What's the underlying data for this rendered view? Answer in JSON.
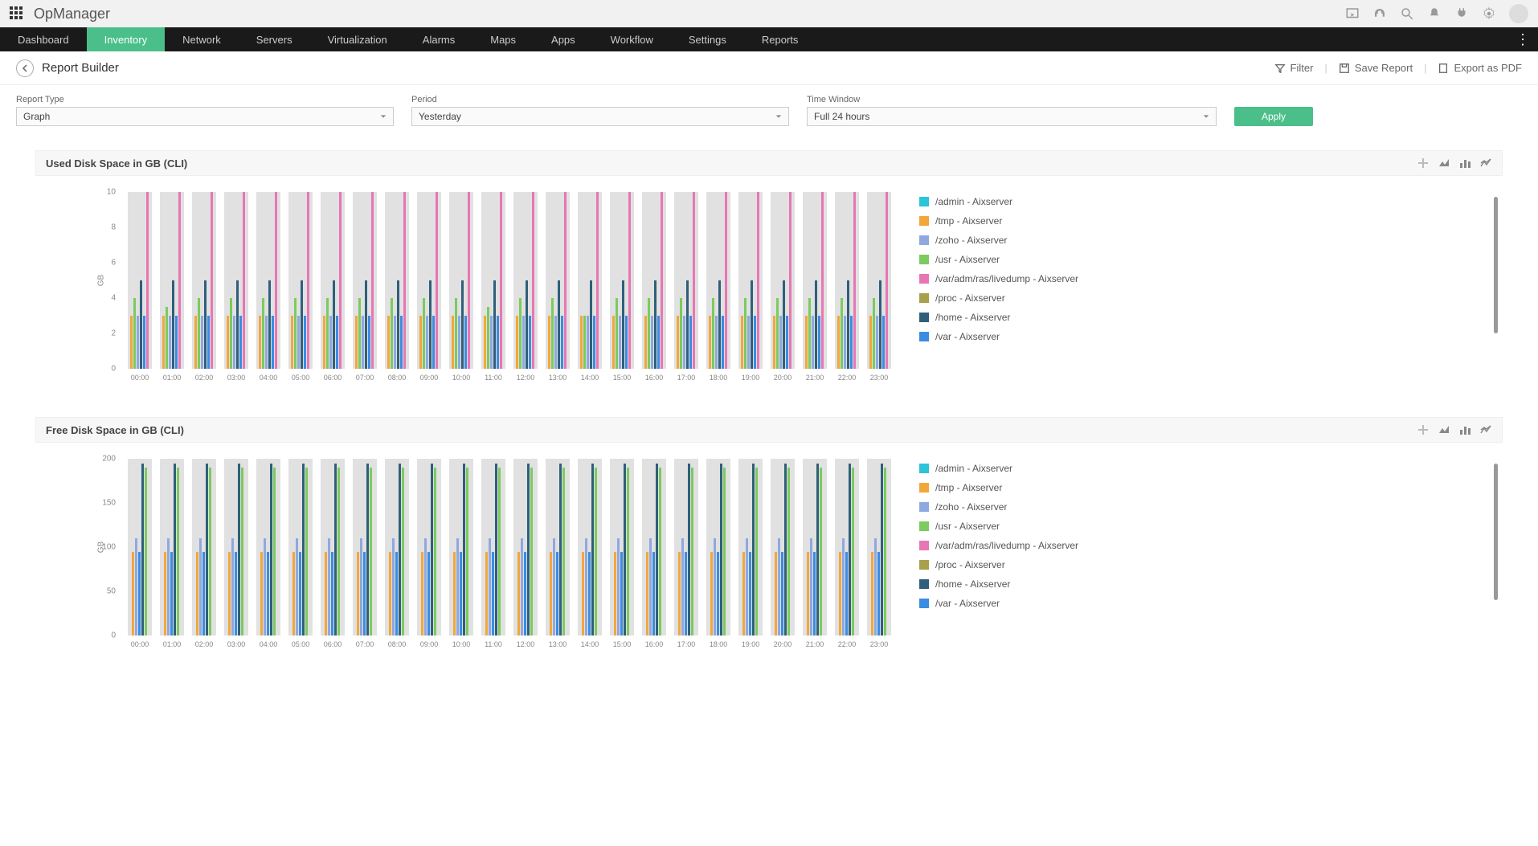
{
  "brand": "OpManager",
  "nav": [
    "Dashboard",
    "Inventory",
    "Network",
    "Servers",
    "Virtualization",
    "Alarms",
    "Maps",
    "Apps",
    "Workflow",
    "Settings",
    "Reports"
  ],
  "nav_active": "Inventory",
  "page": {
    "title": "Report Builder"
  },
  "actions": {
    "filter": "Filter",
    "save": "Save Report",
    "export": "Export as PDF"
  },
  "filters": {
    "report_type": {
      "label": "Report Type",
      "value": "Graph"
    },
    "period": {
      "label": "Period",
      "value": "Yesterday"
    },
    "time_window": {
      "label": "Time Window",
      "value": "Full 24 hours"
    },
    "apply": "Apply"
  },
  "series_colors": {
    "/admin - Aixserver": "#2bc4d8",
    "/tmp - Aixserver": "#f2a73b",
    "/zoho - Aixserver": "#8fa8e0",
    "/usr - Aixserver": "#7bcb5e",
    "/var/adm/ras/livedump - Aixserver": "#e876b5",
    "/proc - Aixserver": "#a8a04a",
    "/home - Aixserver": "#2f5f7a",
    "/var - Aixserver": "#3a8de0"
  },
  "legend_order": [
    "/admin - Aixserver",
    "/tmp - Aixserver",
    "/zoho - Aixserver",
    "/usr - Aixserver",
    "/var/adm/ras/livedump - Aixserver",
    "/proc - Aixserver",
    "/home - Aixserver",
    "/var - Aixserver"
  ],
  "chart_data": [
    {
      "title": "Used Disk Space in GB (CLI)",
      "type": "bar",
      "ylabel": "GB",
      "ylim": [
        0,
        10
      ],
      "yticks": [
        0,
        2,
        4,
        6,
        8,
        10
      ],
      "categories": [
        "00:00",
        "01:00",
        "02:00",
        "03:00",
        "04:00",
        "05:00",
        "06:00",
        "07:00",
        "08:00",
        "09:00",
        "10:00",
        "11:00",
        "12:00",
        "13:00",
        "14:00",
        "15:00",
        "16:00",
        "17:00",
        "18:00",
        "19:00",
        "20:00",
        "21:00",
        "22:00",
        "23:00"
      ],
      "visible_bars": [
        "/tmp - Aixserver",
        "/usr - Aixserver",
        "/zoho - Aixserver",
        "/home - Aixserver",
        "/var - Aixserver",
        "/var/adm/ras/livedump - Aixserver"
      ],
      "values": {
        "/tmp - Aixserver": [
          3,
          3,
          3,
          3,
          3,
          3,
          3,
          3,
          3,
          3,
          3,
          3,
          3,
          3,
          3,
          3,
          3,
          3,
          3,
          3,
          3,
          3,
          3,
          3
        ],
        "/usr - Aixserver": [
          4,
          3.5,
          4,
          4,
          4,
          4,
          4,
          4,
          4,
          4,
          4,
          3.5,
          4,
          4,
          3,
          4,
          4,
          4,
          4,
          4,
          4,
          4,
          4,
          4
        ],
        "/zoho - Aixserver": [
          3,
          3,
          3,
          3,
          3,
          3,
          3,
          3,
          3,
          3,
          3,
          3,
          3,
          3,
          3,
          3,
          3,
          3,
          3,
          3,
          3,
          3,
          3,
          3
        ],
        "/home - Aixserver": [
          5,
          5,
          5,
          5,
          5,
          5,
          5,
          5,
          5,
          5,
          5,
          5,
          5,
          5,
          5,
          5,
          5,
          5,
          5,
          5,
          5,
          5,
          5,
          5
        ],
        "/var - Aixserver": [
          3,
          3,
          3,
          3,
          3,
          3,
          3,
          3,
          3,
          3,
          3,
          3,
          3,
          3,
          3,
          3,
          3,
          3,
          3,
          3,
          3,
          3,
          3,
          3
        ],
        "/var/adm/ras/livedump - Aixserver": [
          10,
          10,
          10,
          10,
          10,
          10,
          10,
          10,
          10,
          10,
          10,
          10,
          10,
          10,
          10,
          10,
          10,
          10,
          10,
          10,
          10,
          10,
          10,
          10
        ]
      },
      "bg_columns": true
    },
    {
      "title": "Free Disk Space in GB (CLI)",
      "type": "bar",
      "ylabel": "GB",
      "ylim": [
        0,
        200
      ],
      "yticks": [
        0,
        50,
        100,
        150,
        200
      ],
      "categories": [
        "00:00",
        "01:00",
        "02:00",
        "03:00",
        "04:00",
        "05:00",
        "06:00",
        "07:00",
        "08:00",
        "09:00",
        "10:00",
        "11:00",
        "12:00",
        "13:00",
        "14:00",
        "15:00",
        "16:00",
        "17:00",
        "18:00",
        "19:00",
        "20:00",
        "21:00",
        "22:00",
        "23:00"
      ],
      "visible_bars": [
        "/tmp - Aixserver",
        "/zoho - Aixserver",
        "/var - Aixserver",
        "/home - Aixserver",
        "/usr - Aixserver"
      ],
      "values": {
        "/tmp - Aixserver": [
          95,
          95,
          95,
          95,
          95,
          95,
          95,
          95,
          95,
          95,
          95,
          95,
          95,
          95,
          95,
          95,
          95,
          95,
          95,
          95,
          95,
          95,
          95,
          95
        ],
        "/zoho - Aixserver": [
          110,
          110,
          110,
          110,
          110,
          110,
          110,
          110,
          110,
          110,
          110,
          110,
          110,
          110,
          110,
          110,
          110,
          110,
          110,
          110,
          110,
          110,
          110,
          110
        ],
        "/var - Aixserver": [
          95,
          95,
          95,
          95,
          95,
          95,
          95,
          95,
          95,
          95,
          95,
          95,
          95,
          95,
          95,
          95,
          95,
          95,
          95,
          95,
          95,
          95,
          95,
          95
        ],
        "/home - Aixserver": [
          195,
          195,
          195,
          195,
          195,
          195,
          195,
          195,
          195,
          195,
          195,
          195,
          195,
          195,
          195,
          195,
          195,
          195,
          195,
          195,
          195,
          195,
          195,
          195
        ],
        "/usr - Aixserver": [
          190,
          190,
          190,
          190,
          190,
          190,
          190,
          190,
          190,
          190,
          190,
          190,
          190,
          190,
          190,
          190,
          190,
          190,
          190,
          190,
          190,
          190,
          190,
          190
        ]
      },
      "bg_columns": true
    }
  ]
}
